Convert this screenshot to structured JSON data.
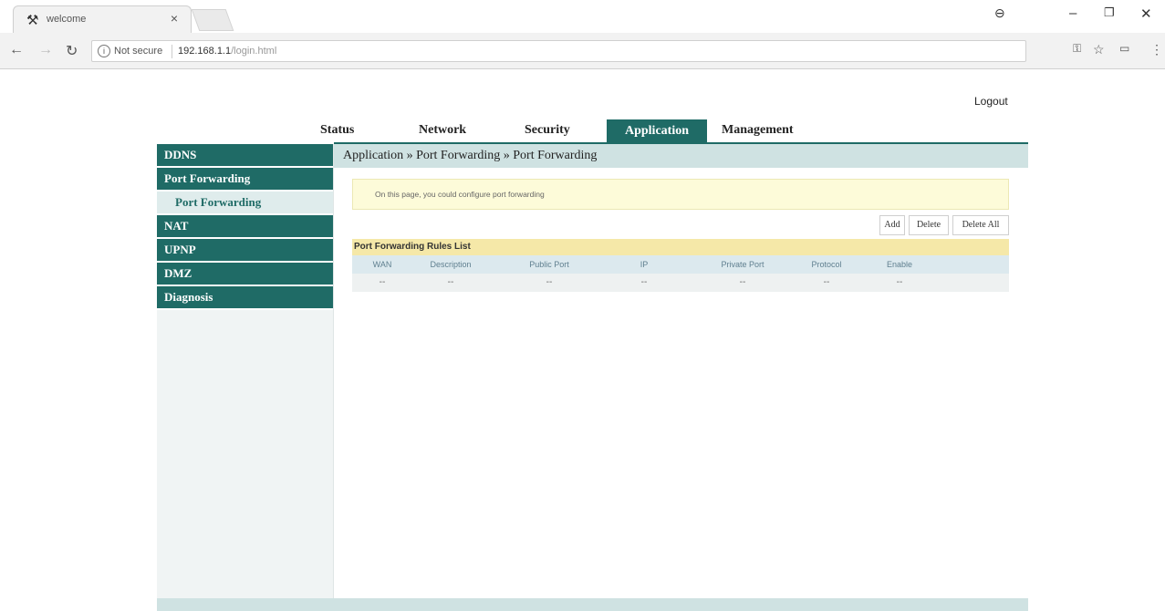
{
  "browser": {
    "tab_title": "welcome",
    "url_security": "Not secure",
    "url_host": "192.168.1.1",
    "url_path": "/login.html"
  },
  "page": {
    "logout": "Logout",
    "top_nav": [
      "Status",
      "Network",
      "Security",
      "Application",
      "Management"
    ],
    "active_tab": "Application",
    "sidebar": {
      "items": [
        "DDNS",
        "Port Forwarding",
        "NAT",
        "UPNP",
        "DMZ",
        "Diagnosis"
      ],
      "sub_item": "Port Forwarding"
    },
    "breadcrumb": "Application » Port Forwarding » Port Forwarding",
    "notice": "On this page, you could configure port forwarding",
    "buttons": {
      "add": "Add",
      "delete": "Delete",
      "delete_all": "Delete All"
    },
    "table": {
      "title": "Port Forwarding Rules List",
      "columns": [
        "WAN",
        "Description",
        "Public Port",
        "IP",
        "Private Port",
        "Protocol",
        "Enable"
      ],
      "row": [
        "--",
        "--",
        "--",
        "--",
        "--",
        "--",
        "--"
      ]
    }
  },
  "colors": {
    "accent": "#1f6b66",
    "breadcrumb_bg": "#cfe2e2",
    "notice_bg": "#fdfbd9",
    "table_title_bg": "#f5e8a8"
  }
}
